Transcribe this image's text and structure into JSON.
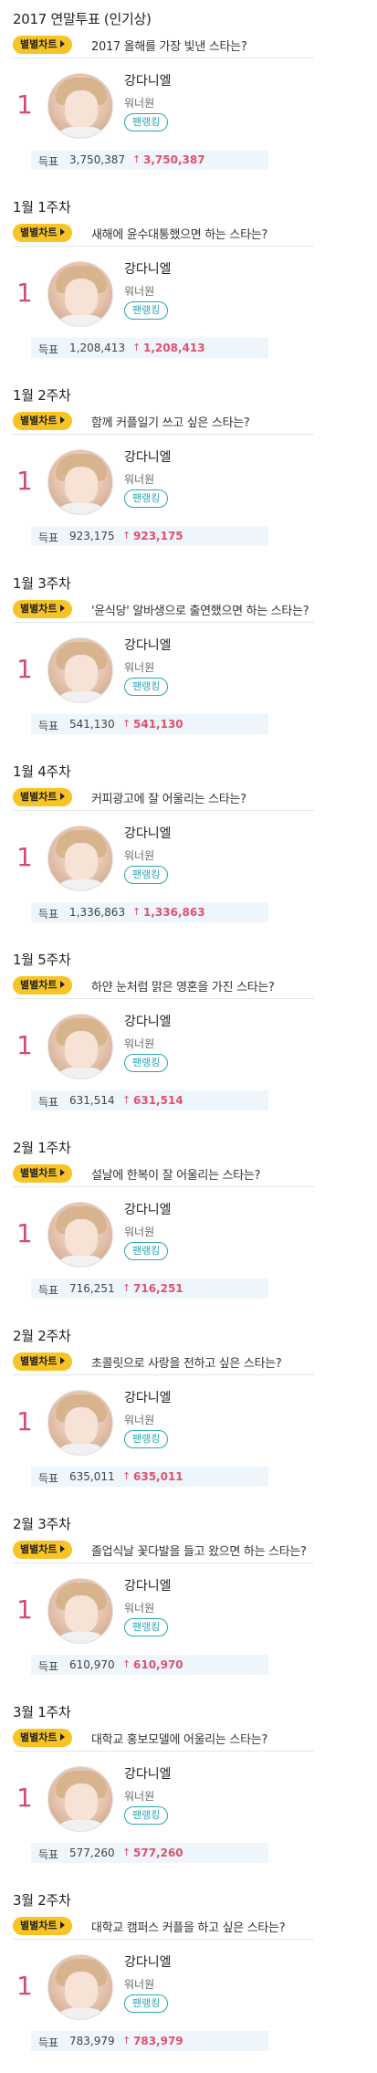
{
  "common": {
    "badge_label": "별별차트",
    "star_name": "강다니엘",
    "group_name": "워너원",
    "fan_button": "팬랭킹",
    "rank": "1",
    "votes_label": "득표",
    "up_arrow": "↑",
    "colors": {
      "badge": "#f7c325",
      "rank": "#d24a7a",
      "delta": "#e0506f",
      "fan_button": "#2aa7b4",
      "votes_bg": "#eef6fb"
    }
  },
  "sections": [
    {
      "title": "2017 연말투표 (인기상)",
      "question": "2017 올해를 가장 빛낸 스타는?",
      "votes": "3,750,387",
      "delta": "3,750,387"
    },
    {
      "title": "1월 1주차",
      "question": "새해에 윤수대통했으면 하는 스타는?",
      "votes": "1,208,413",
      "delta": "1,208,413"
    },
    {
      "title": "1월 2주차",
      "question": "함께 커플일기 쓰고 싶은 스타는?",
      "votes": "923,175",
      "delta": "923,175"
    },
    {
      "title": "1월 3주차",
      "question": "'윤식당' 알바생으로 출연했으면 하는 스타는?",
      "votes": "541,130",
      "delta": "541,130"
    },
    {
      "title": "1월 4주차",
      "question": "커피광고에 잘 어울리는 스타는?",
      "votes": "1,336,863",
      "delta": "1,336,863"
    },
    {
      "title": "1월 5주차",
      "question": "하얀 눈처럼 맑은 영혼을 가진 스타는?",
      "votes": "631,514",
      "delta": "631,514"
    },
    {
      "title": "2월 1주차",
      "question": "설날에 한복이 잘 어울리는 스타는?",
      "votes": "716,251",
      "delta": "716,251"
    },
    {
      "title": "2월 2주차",
      "question": "초콜릿으로 사랑을 전하고 싶은 스타는?",
      "votes": "635,011",
      "delta": "635,011"
    },
    {
      "title": "2월 3주차",
      "question": "졸업식날 꽃다발을 들고 왔으면 하는 스타는?",
      "votes": "610,970",
      "delta": "610,970"
    },
    {
      "title": "3월 1주차",
      "question": "대학교 홍보모델에 어울리는 스타는?",
      "votes": "577,260",
      "delta": "577,260"
    },
    {
      "title": "3월 2주차",
      "question": "대학교 캠퍼스 커플을 하고 싶은 스타는?",
      "votes": "783,979",
      "delta": "783,979"
    }
  ]
}
